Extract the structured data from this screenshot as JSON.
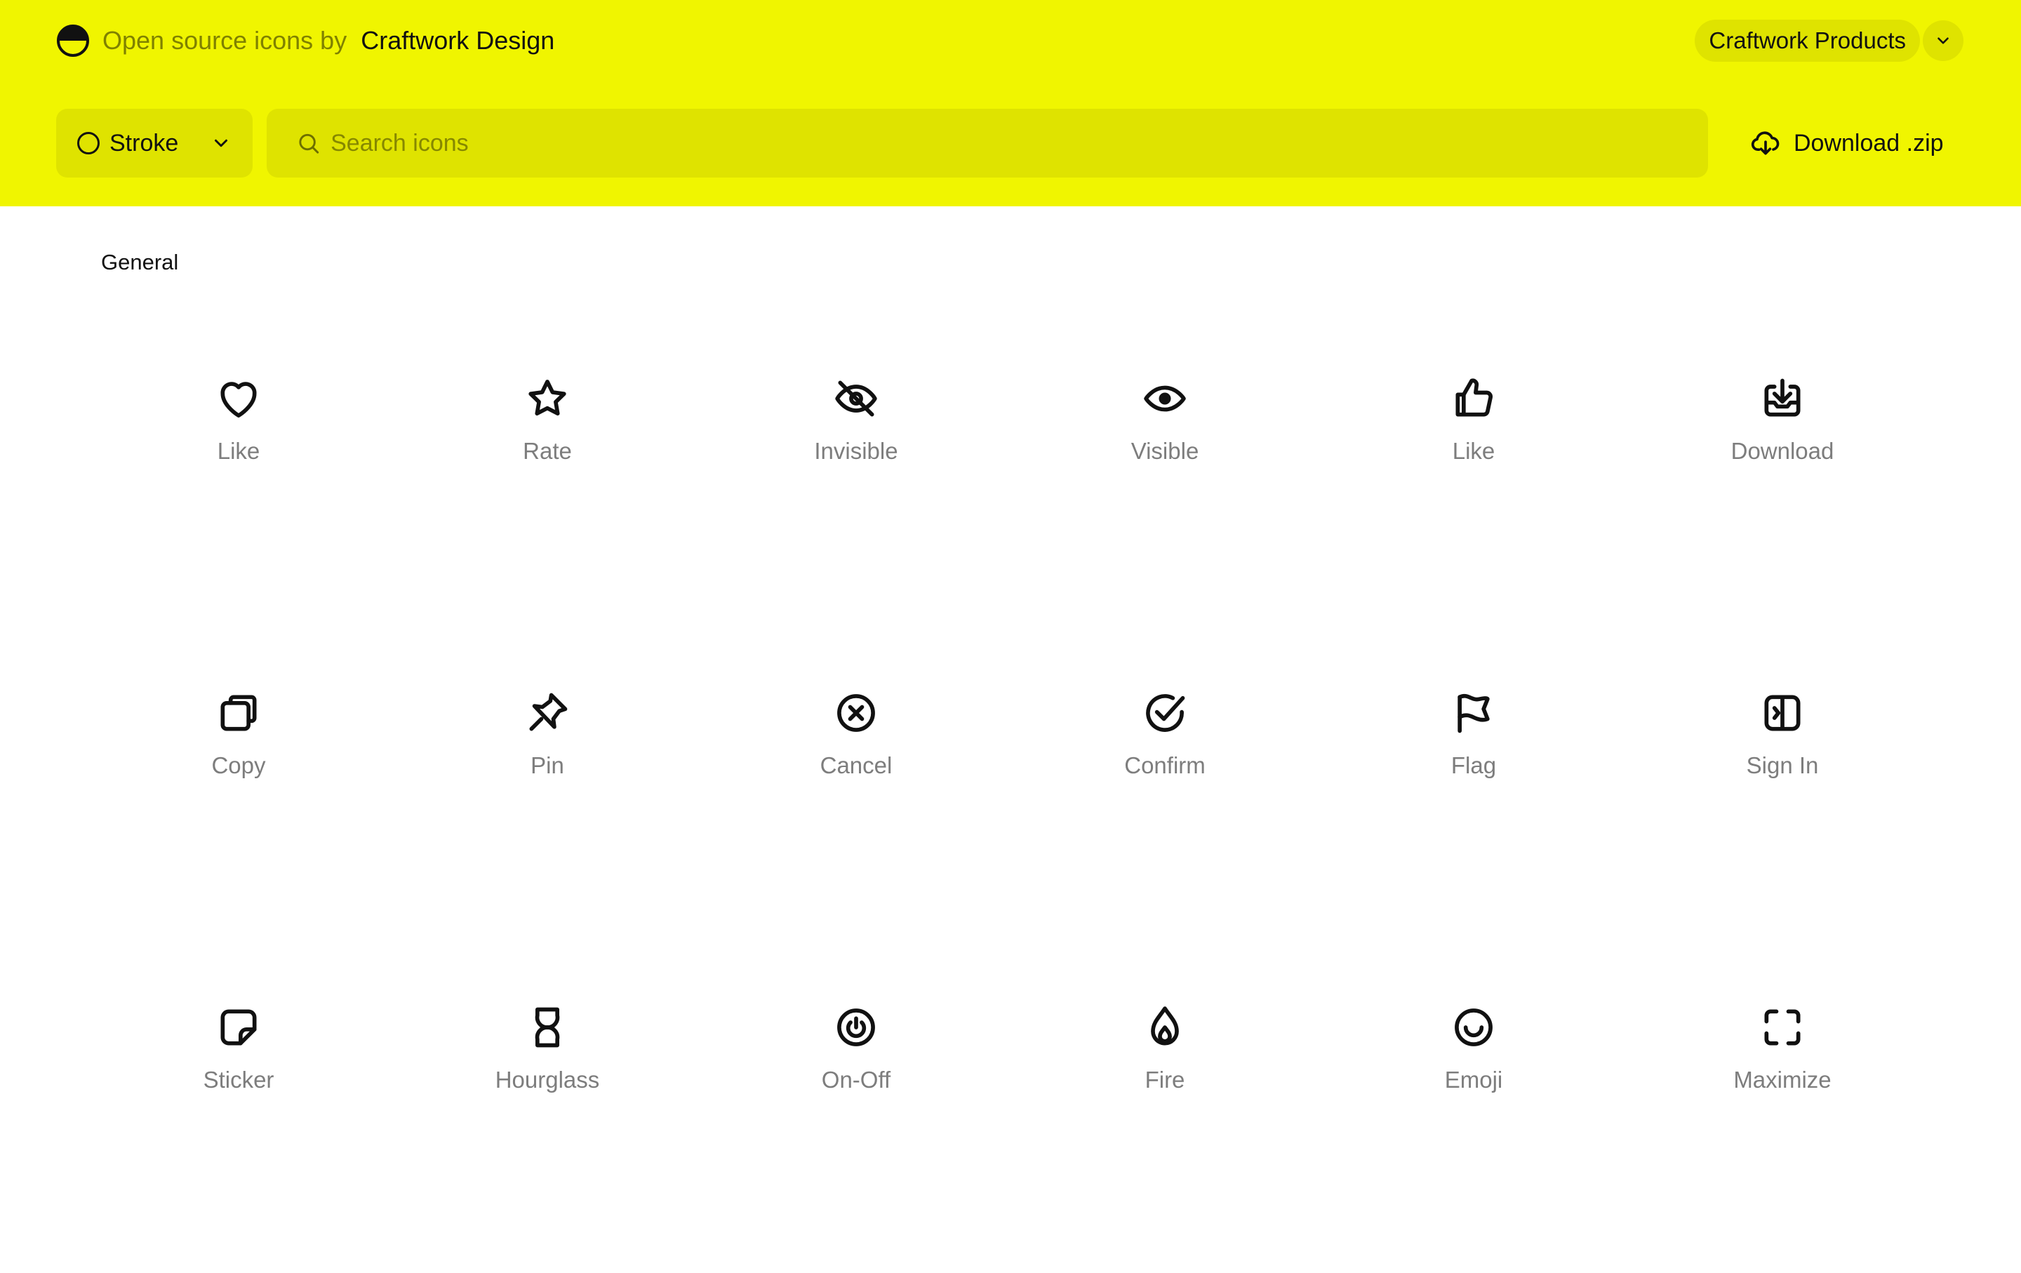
{
  "header": {
    "tagline": "Open source icons by",
    "brand_name": "Craftwork Design",
    "products_label": "Craftwork Products",
    "style_select": {
      "value": "Stroke"
    },
    "search": {
      "placeholder": "Search icons",
      "value": ""
    },
    "download_label": "Download .zip",
    "colors": {
      "header_bg": "#f0f500",
      "control_bg": "#dfe300"
    }
  },
  "section": {
    "title": "General"
  },
  "icons": [
    {
      "name": "heart-icon",
      "label": "Like"
    },
    {
      "name": "star-icon",
      "label": "Rate"
    },
    {
      "name": "eye-off-icon",
      "label": "Invisible"
    },
    {
      "name": "eye-icon",
      "label": "Visible"
    },
    {
      "name": "thumbs-up-icon",
      "label": "Like"
    },
    {
      "name": "download-icon",
      "label": "Download"
    },
    {
      "name": "copy-icon",
      "label": "Copy"
    },
    {
      "name": "pin-icon",
      "label": "Pin"
    },
    {
      "name": "cancel-icon",
      "label": "Cancel"
    },
    {
      "name": "confirm-icon",
      "label": "Confirm"
    },
    {
      "name": "flag-icon",
      "label": "Flag"
    },
    {
      "name": "sign-in-icon",
      "label": "Sign In"
    },
    {
      "name": "sticker-icon",
      "label": "Sticker"
    },
    {
      "name": "hourglass-icon",
      "label": "Hourglass"
    },
    {
      "name": "power-icon",
      "label": "On-Off"
    },
    {
      "name": "fire-icon",
      "label": "Fire"
    },
    {
      "name": "emoji-icon",
      "label": "Emoji"
    },
    {
      "name": "maximize-icon",
      "label": "Maximize"
    }
  ]
}
